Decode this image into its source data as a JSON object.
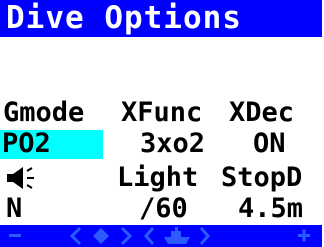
{
  "title": "Dive Options",
  "options": [
    {
      "label": "Gmode",
      "value": "PO2",
      "selected": true
    },
    {
      "label": "XFunc",
      "value": "3xo2"
    },
    {
      "label": "XDec",
      "value": "ON"
    },
    {
      "label": "",
      "value": "N",
      "icon": "speaker-icon"
    },
    {
      "label": "Light",
      "value": "/60"
    },
    {
      "label": "StopD",
      "value": "4.5m"
    }
  ],
  "softkeys": [
    {
      "name": "minus-icon"
    },
    {
      "name": "adjust-diamond-icon"
    },
    {
      "name": "dive-boat-icon"
    },
    {
      "name": "plus-icon"
    }
  ],
  "colors": {
    "title_bar": "#0000ff",
    "title_text": "#ffffff",
    "selection": "#00ffff",
    "softkey_bar": "#0000ff",
    "softkey_icon": "#2b5bff"
  }
}
